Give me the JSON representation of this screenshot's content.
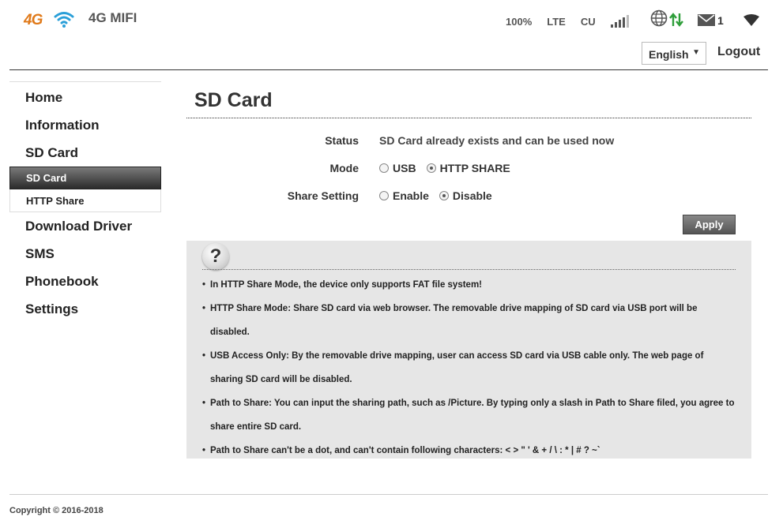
{
  "header": {
    "logo_text": "4G",
    "device_name": "4G MIFI",
    "battery": "100%",
    "network_type": "LTE",
    "carrier": "CU",
    "message_count": "1",
    "language": "English",
    "logout_label": "Logout",
    "icons": [
      "4g-wifi-logo",
      "signal-bars-icon",
      "globe-icon",
      "data-transfer-icon",
      "mail-icon",
      "wifi-icon",
      "dropdown-caret-icon"
    ]
  },
  "sidebar": {
    "items": [
      {
        "label": "Home"
      },
      {
        "label": "Information"
      },
      {
        "label": "SD Card"
      },
      {
        "label": "SD Card",
        "sub": true,
        "active": true
      },
      {
        "label": "HTTP Share",
        "sub": true
      },
      {
        "label": "Download Driver"
      },
      {
        "label": "SMS"
      },
      {
        "label": "Phonebook"
      },
      {
        "label": "Settings"
      }
    ]
  },
  "main": {
    "title": "SD Card",
    "status_label": "Status",
    "status_value": "SD Card already exists and can be used now",
    "mode_label": "Mode",
    "mode_options": [
      "USB",
      "HTTP SHARE"
    ],
    "mode_selected": "HTTP SHARE",
    "share_label": "Share Setting",
    "share_options": [
      "Enable",
      "Disable"
    ],
    "share_selected": "Disable",
    "apply_label": "Apply"
  },
  "help": {
    "icon": "?",
    "items": [
      "In HTTP Share Mode, the device only supports FAT file system!",
      "HTTP Share Mode: Share SD card via web browser. The removable drive mapping of SD card via USB port will be disabled.",
      "USB Access Only: By the removable drive mapping, user can access SD card via USB cable only. The web page of sharing SD card will be disabled.",
      "Path to Share: You can input the sharing path, such as /Picture. By typing only a slash in Path to Share filed, you agree to share entire SD card.",
      "Path to Share can't be a dot, and can't contain following characters: < > \" ' & + / \\ : * | # ? ~`"
    ]
  },
  "footer": {
    "copyright": "Copyright © 2016-2018"
  },
  "colors": {
    "logo_orange": "#e07a1a",
    "logo_blue": "#2a9fd8",
    "data_arrow_green": "#2e9e3a",
    "active_nav_bg": "#2b2b2b",
    "help_bg": "#e6e6e6"
  }
}
